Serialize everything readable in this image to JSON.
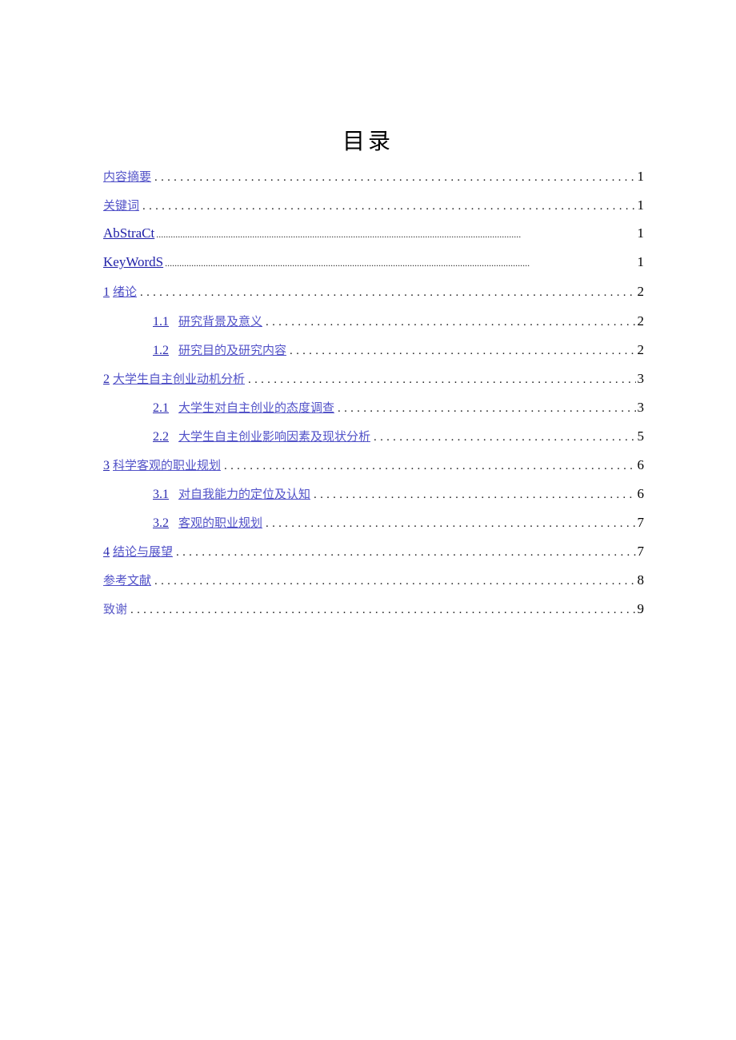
{
  "document": {
    "title": "目录",
    "toc": [
      {
        "number": "",
        "label": "内容摘要",
        "page": "1",
        "level": 1,
        "style": "cjk"
      },
      {
        "number": "",
        "label": "关键词",
        "page": "1",
        "level": 1,
        "style": "cjk"
      },
      {
        "number": "",
        "label": "AbStraCt",
        "page": "1",
        "level": 1,
        "style": "latin"
      },
      {
        "number": "",
        "label": "KeyWordS",
        "page": "1",
        "level": 1,
        "style": "latin"
      },
      {
        "number": "1",
        "label": "绪论",
        "page": "2",
        "level": 1,
        "style": "cjk"
      },
      {
        "number": "1.1",
        "label": "研究背景及意义",
        "page": "2",
        "level": 2,
        "style": "cjk"
      },
      {
        "number": "1.2",
        "label": "研究目的及研究内容",
        "page": "2",
        "level": 2,
        "style": "cjk"
      },
      {
        "number": "2",
        "label": "大学生自主创业动机分析",
        "page": "3",
        "level": 1,
        "style": "cjk"
      },
      {
        "number": "2.1",
        "label": "大学生对自主创业的态度调查",
        "page": "3",
        "level": 2,
        "style": "cjk"
      },
      {
        "number": "2.2",
        "label": "大学生自主创业影响因素及现状分析",
        "page": "5",
        "level": 2,
        "style": "cjk"
      },
      {
        "number": "3",
        "label": "科学客观的职业规划",
        "page": "6",
        "level": 1,
        "style": "cjk"
      },
      {
        "number": "3.1",
        "label": "对自我能力的定位及认知",
        "page": "6",
        "level": 2,
        "style": "cjk"
      },
      {
        "number": "3.2",
        "label": "客观的职业规划",
        "page": "7",
        "level": 2,
        "style": "cjk"
      },
      {
        "number": "4",
        "label": "结论与展望",
        "page": "7",
        "level": 1,
        "style": "cjk"
      },
      {
        "number": "",
        "label": "参考文献",
        "page": "8",
        "level": 1,
        "style": "cjk"
      },
      {
        "number": "",
        "label": "致谢",
        "page": "9",
        "level": 1,
        "style": "plain"
      }
    ],
    "leader_dots": "........................................................................................................................................................"
  },
  "colors": {
    "link": "#5252c8",
    "link_latin": "#2020a8",
    "text": "#000000"
  }
}
